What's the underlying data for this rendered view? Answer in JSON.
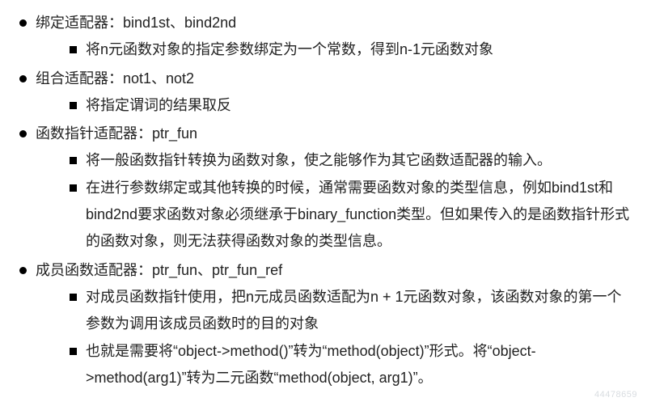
{
  "items": [
    {
      "title": "绑定适配器：bind1st、bind2nd",
      "subs": [
        "将n元函数对象的指定参数绑定为一个常数，得到n-1元函数对象"
      ]
    },
    {
      "title": "组合适配器：not1、not2",
      "subs": [
        "将指定谓词的结果取反"
      ]
    },
    {
      "title": "函数指针适配器：ptr_fun",
      "subs": [
        "将一般函数指针转换为函数对象，使之能够作为其它函数适配器的输入。",
        "在进行参数绑定或其他转换的时候，通常需要函数对象的类型信息，例如bind1st和bind2nd要求函数对象必须继承于binary_function类型。但如果传入的是函数指针形式的函数对象，则无法获得函数对象的类型信息。"
      ]
    },
    {
      "title": "成员函数适配器：ptr_fun、ptr_fun_ref",
      "subs": [
        "对成员函数指针使用，把n元成员函数适配为n + 1元函数对象，该函数对象的第一个参数为调用该成员函数时的目的对象",
        "也就是需要将“object->method()”转为“method(object)”形式。将“object->method(arg1)”转为二元函数“method(object, arg1)”。"
      ]
    }
  ],
  "watermark": "44478659"
}
